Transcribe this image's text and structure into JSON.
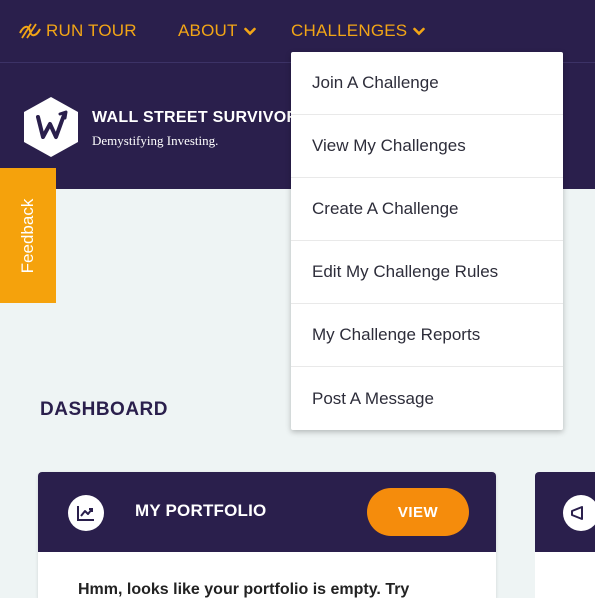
{
  "nav": {
    "run_tour": "RUN TOUR",
    "about": "ABOUT",
    "challenges": "CHALLENGES"
  },
  "brand": {
    "name": "WALL STREET SURVIVOR",
    "tagline": "Demystifying Investing."
  },
  "feedback": {
    "label": "Feedback"
  },
  "challenges_menu": {
    "items": [
      "Join A Challenge",
      "View My Challenges",
      "Create A Challenge",
      "Edit My Challenge Rules",
      "My Challenge Reports",
      "Post A Message"
    ]
  },
  "dashboard": {
    "title": "DASHBOARD",
    "portfolio_card": {
      "title": "MY PORTFOLIO",
      "view_label": "VIEW",
      "body": "Hmm, looks like your portfolio is empty. Try"
    }
  },
  "colors": {
    "navy": "#2a1f4c",
    "orange": "#f2a516",
    "button_orange": "#f58c0c",
    "page_bg": "#eef4f4"
  }
}
